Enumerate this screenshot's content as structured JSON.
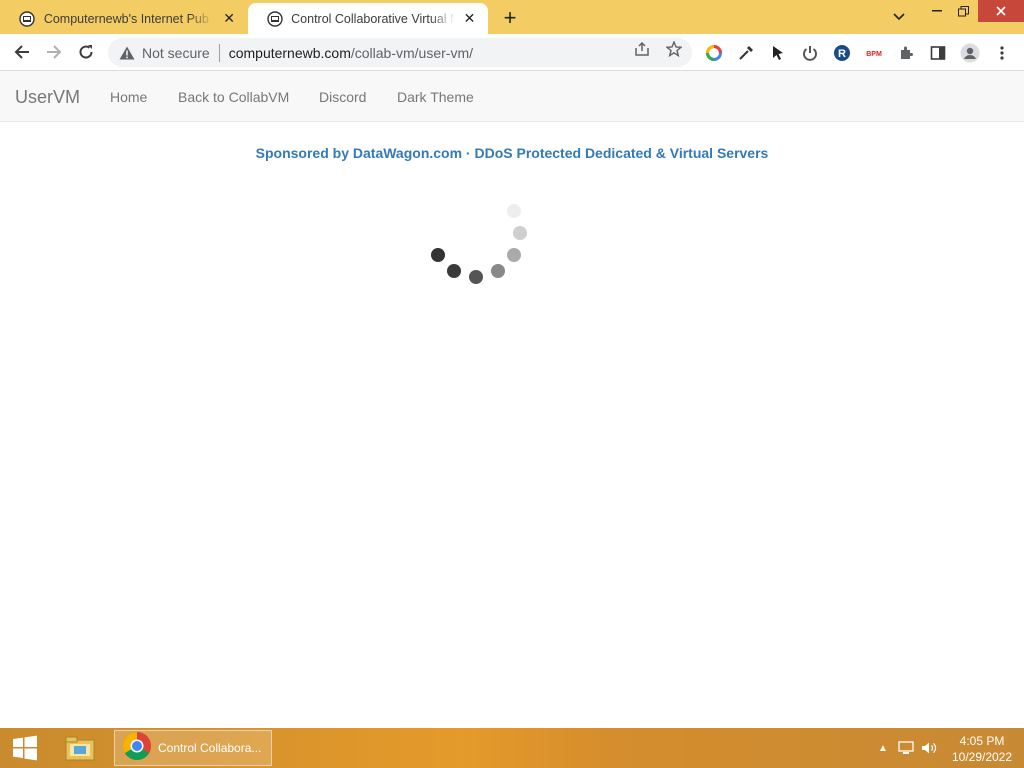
{
  "browser": {
    "tabs": [
      {
        "title": "Computernewb's Internet Pub Hu",
        "active": false
      },
      {
        "title": "Control Collaborative Virtual Mac",
        "active": true
      }
    ],
    "new_tab_label": "+",
    "address": {
      "security_text": "Not secure",
      "host": "computernewb.com",
      "path": "/collab-vm/user-vm/"
    }
  },
  "page": {
    "brand": "UserVM",
    "nav_links": [
      "Home",
      "Back to CollabVM",
      "Discord",
      "Dark Theme"
    ],
    "sponsor": "Sponsored by DataWagon.com · DDoS Protected Dedicated & Virtual Servers",
    "sponsor_color": "#337ab7"
  },
  "taskbar": {
    "task_label": "Control Collabora...",
    "time": "4:05 PM",
    "date": "10/29/2022",
    "accent": "#e59a2a"
  },
  "icons": [
    "back-icon",
    "forward-icon",
    "reload-icon",
    "warning-icon",
    "share-icon",
    "star-icon",
    "extension-icon",
    "profile-icon",
    "menu-icon",
    "windows-logo-icon",
    "folder-icon",
    "chrome-icon"
  ]
}
